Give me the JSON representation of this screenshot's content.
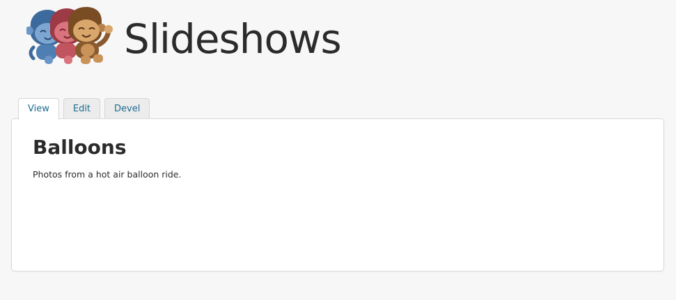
{
  "site": {
    "name": "Slideshows"
  },
  "tabs": [
    {
      "label": "View",
      "active": true
    },
    {
      "label": "Edit",
      "active": false
    },
    {
      "label": "Devel",
      "active": false
    }
  ],
  "node": {
    "title": "Balloons",
    "body": "Photos from a hot air balloon ride."
  },
  "colors": {
    "page_background": "#f7f7f7",
    "tab_link": "#1c6b8f",
    "text": "#2b2b2b",
    "logo_monkeys": [
      "#4f7eb3",
      "#c05560",
      "#8a5a2f"
    ]
  }
}
